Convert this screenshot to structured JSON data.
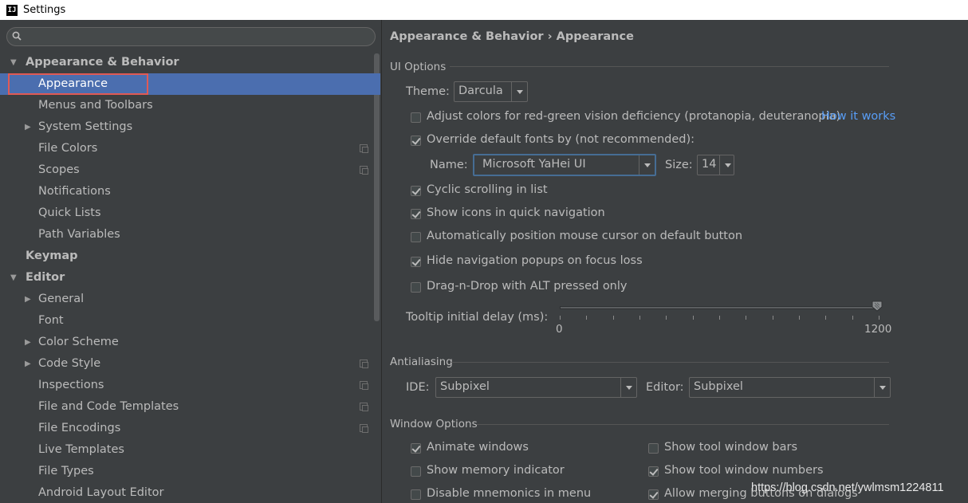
{
  "window": {
    "title": "Settings",
    "app_icon_text": "IJ"
  },
  "sidebar": {
    "search": {
      "value": "",
      "placeholder": ""
    },
    "items": [
      {
        "label": "Appearance & Behavior",
        "level": 0,
        "expanded": true,
        "bold": true
      },
      {
        "label": "Appearance",
        "level": 1,
        "selected": true
      },
      {
        "label": "Menus and Toolbars",
        "level": 1
      },
      {
        "label": "System Settings",
        "level": 1,
        "collapsed": true
      },
      {
        "label": "File Colors",
        "level": 1,
        "project_icon": true
      },
      {
        "label": "Scopes",
        "level": 1,
        "project_icon": true
      },
      {
        "label": "Notifications",
        "level": 1
      },
      {
        "label": "Quick Lists",
        "level": 1
      },
      {
        "label": "Path Variables",
        "level": 1
      },
      {
        "label": "Keymap",
        "level": 0,
        "bold": true
      },
      {
        "label": "Editor",
        "level": 0,
        "expanded": true,
        "bold": true
      },
      {
        "label": "General",
        "level": 1,
        "collapsed": true
      },
      {
        "label": "Font",
        "level": 1
      },
      {
        "label": "Color Scheme",
        "level": 1,
        "collapsed": true
      },
      {
        "label": "Code Style",
        "level": 1,
        "collapsed": true,
        "project_icon": true
      },
      {
        "label": "Inspections",
        "level": 1,
        "project_icon": true
      },
      {
        "label": "File and Code Templates",
        "level": 1,
        "project_icon": true
      },
      {
        "label": "File Encodings",
        "level": 1,
        "project_icon": true
      },
      {
        "label": "Live Templates",
        "level": 1
      },
      {
        "label": "File Types",
        "level": 1
      },
      {
        "label": "Android Layout Editor",
        "level": 1
      }
    ]
  },
  "main": {
    "breadcrumb": "Appearance & Behavior › Appearance",
    "ui_options": {
      "title": "UI Options",
      "theme_label": "Theme:",
      "theme_value": "Darcula",
      "adjust_colors": {
        "label": "Adjust colors for red-green vision deficiency (protanopia, deuteranopia)",
        "checked": false
      },
      "how_it_works": "How it works",
      "override_fonts": {
        "label": "Override default fonts by (not recommended):",
        "checked": true
      },
      "font_name_label": "Name:",
      "font_name_value": "Microsoft YaHei UI",
      "font_size_label": "Size:",
      "font_size_value": "14",
      "cyclic_scrolling": {
        "label": "Cyclic scrolling in list",
        "checked": true
      },
      "show_icons": {
        "label": "Show icons in quick navigation",
        "checked": true
      },
      "auto_position": {
        "label": "Automatically position mouse cursor on default button",
        "checked": false
      },
      "hide_nav_popups": {
        "label": "Hide navigation popups on focus loss",
        "checked": true
      },
      "drag_n_drop": {
        "label": "Drag-n-Drop with ALT pressed only",
        "checked": false
      },
      "tooltip_label": "Tooltip initial delay (ms):",
      "tooltip_min": "0",
      "tooltip_max": "1200",
      "tooltip_value": 1200
    },
    "antialiasing": {
      "title": "Antialiasing",
      "ide_label": "IDE:",
      "ide_value": "Subpixel",
      "editor_label": "Editor:",
      "editor_value": "Subpixel"
    },
    "window_options": {
      "title": "Window Options",
      "animate_windows": {
        "label": "Animate windows",
        "checked": true
      },
      "show_memory": {
        "label": "Show memory indicator",
        "checked": false
      },
      "disable_mnemonics": {
        "label": "Disable mnemonics in menu",
        "checked": false
      },
      "show_tool_bars": {
        "label": "Show tool window bars",
        "checked": false
      },
      "show_tool_numbers": {
        "label": "Show tool window numbers",
        "checked": true
      },
      "allow_merging": {
        "label": "Allow merging buttons on dialogs",
        "checked": true
      }
    }
  },
  "watermark": "https://blog.csdn.net/ywlmsm1224811",
  "colors": {
    "selection": "#4b6eaf",
    "link": "#589df6",
    "highlight": "#e05a55",
    "background": "#3c3f41"
  }
}
